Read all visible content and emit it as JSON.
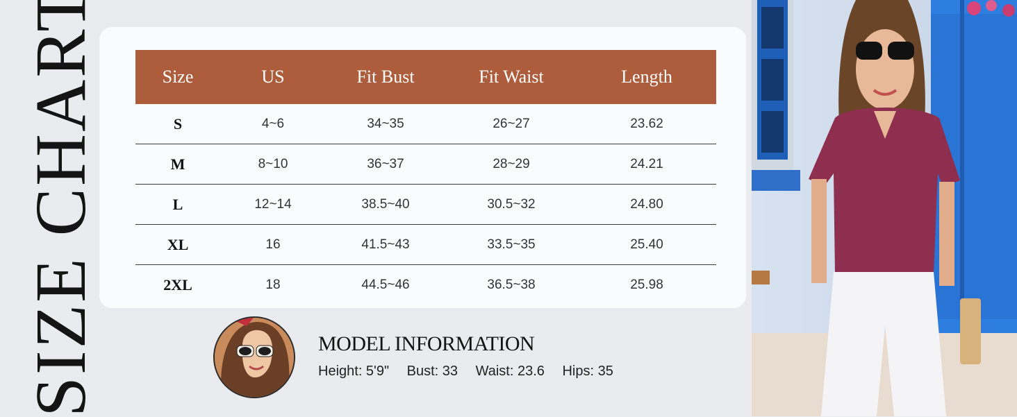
{
  "vertical_title": "SIZE CHART",
  "table": {
    "headers": [
      "Size",
      "US",
      "Fit Bust",
      "Fit Waist",
      "Length"
    ],
    "rows": [
      [
        "S",
        "4~6",
        "34~35",
        "26~27",
        "23.62"
      ],
      [
        "M",
        "8~10",
        "36~37",
        "28~29",
        "24.21"
      ],
      [
        "L",
        "12~14",
        "38.5~40",
        "30.5~32",
        "24.80"
      ],
      [
        "XL",
        "16",
        "41.5~43",
        "33.5~35",
        "25.40"
      ],
      [
        "2XL",
        "18",
        "44.5~46",
        "36.5~38",
        "25.98"
      ]
    ]
  },
  "model": {
    "title": "MODEL INFORMATION",
    "stats": [
      "Height: 5'9\"",
      "Bust: 33",
      "Waist: 23.6",
      "Hips: 35"
    ]
  },
  "colors": {
    "header_bg": "#ad5d3b",
    "page_bg": "#e9ebee",
    "card_bg": "#fafbfc",
    "shirt": "#8e2f4f"
  }
}
